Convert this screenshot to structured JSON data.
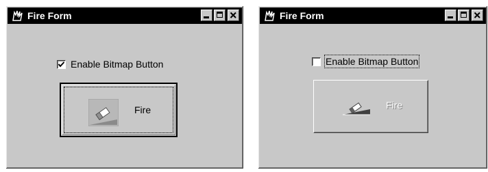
{
  "windows": [
    {
      "title": "Fire Form",
      "checkbox": {
        "label": "Enable Bitmap Button",
        "checked": true
      },
      "fire_button": {
        "label": "Fire",
        "enabled": true
      }
    },
    {
      "title": "Fire Form",
      "checkbox": {
        "label": "Enable Bitmap Button",
        "checked": false
      },
      "fire_button": {
        "label": "Fire",
        "enabled": false
      }
    }
  ],
  "icons": {
    "app": "fire-app-icon",
    "minimize": "minimize-icon",
    "maximize": "maximize-icon",
    "close": "close-icon",
    "bitmap": "eraser-bitmap-icon"
  },
  "colors": {
    "titlebar": "#000000",
    "window_face": "#c8c8c8"
  }
}
